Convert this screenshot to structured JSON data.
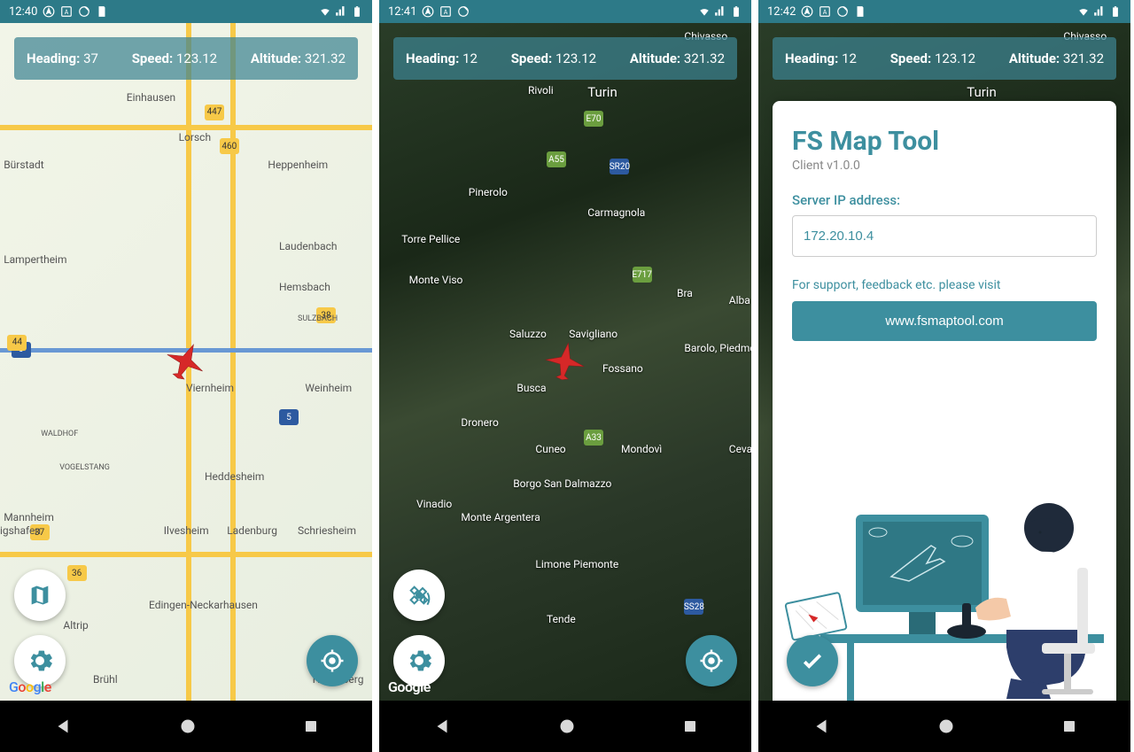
{
  "screens": [
    {
      "time": "12:40",
      "telemetry": {
        "heading_label": "Heading:",
        "heading": "37",
        "speed_label": "Speed:",
        "speed": "123.12",
        "altitude_label": "Altitude:",
        "altitude": "321.32"
      },
      "map_type": "road",
      "map_labels": [
        "Einhausen",
        "Lorsch",
        "Bürstadt",
        "Heppenheim",
        "Laudenbach",
        "Lampertheim",
        "Hemsbach",
        "SULZBACH",
        "Viernheim",
        "Weinheim",
        "WALDHOF",
        "VOGELSTANG",
        "Heddesheim",
        "Mannheim",
        "igshafen",
        "Ilvesheim",
        "Ladenburg",
        "Schriesheim",
        "Altrip",
        "Edingen-Neckarhausen",
        "Brühl",
        "Heidelberg"
      ],
      "google": "Google"
    },
    {
      "time": "12:41",
      "telemetry": {
        "heading_label": "Heading:",
        "heading": "12",
        "speed_label": "Speed:",
        "speed": "123.12",
        "altitude_label": "Altitude:",
        "altitude": "321.32"
      },
      "map_type": "satellite",
      "map_labels": [
        "Chivasso",
        "Turin",
        "Rivoli",
        "Pinerolo",
        "Carmagnola",
        "Torre Pellice",
        "Monte Viso",
        "Bra",
        "Alba",
        "Saluzzo",
        "Savigliano",
        "Barolo, Piedmont",
        "Busca",
        "Fossano",
        "Dronero",
        "Cuneo",
        "Mondovì",
        "Ceva",
        "Vinadio",
        "Borgo San Dalmazzo",
        "Monte Argentera",
        "Limone Piemonte",
        "Tende"
      ],
      "road_shields": [
        "E70",
        "A55",
        "SR20",
        "E717",
        "A33",
        "SS28"
      ],
      "google": "Google"
    },
    {
      "time": "12:42",
      "telemetry": {
        "heading_label": "Heading:",
        "heading": "12",
        "speed_label": "Speed:",
        "speed": "123.12",
        "altitude_label": "Altitude:",
        "altitude": "321.32"
      },
      "map_type": "satellite",
      "map_labels": [
        "Chivasso",
        "Turin"
      ],
      "settings": {
        "title": "FS Map Tool",
        "version": "Client v1.0.0",
        "ip_label": "Server IP address:",
        "ip_value": "172.20.10.4",
        "support_text": "For support, feedback etc. please visit",
        "website": "www.fsmaptool.com"
      }
    }
  ]
}
